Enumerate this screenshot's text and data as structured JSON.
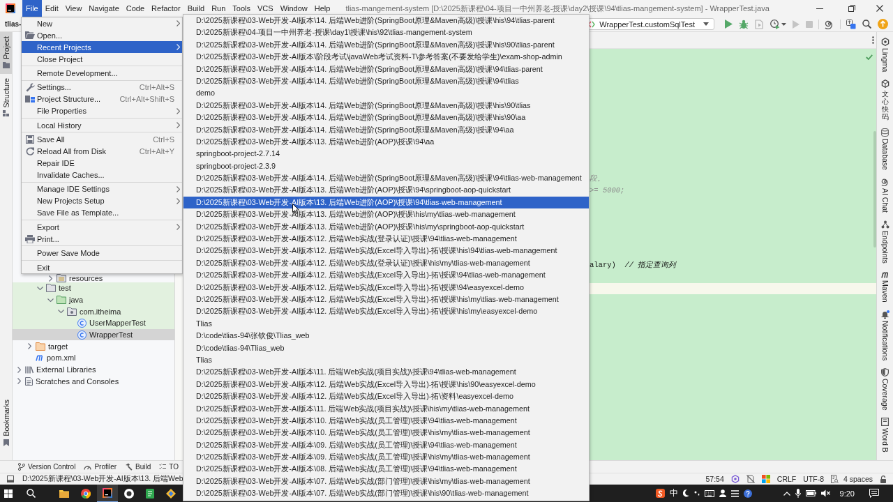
{
  "menu_bar": {
    "items": [
      {
        "label": "File",
        "selected": true
      },
      {
        "label": "Edit",
        "selected": false
      },
      {
        "label": "View",
        "selected": false
      },
      {
        "label": "Navigate",
        "selected": false
      },
      {
        "label": "Code",
        "selected": false
      },
      {
        "label": "Refactor",
        "selected": false
      },
      {
        "label": "Build",
        "selected": false
      },
      {
        "label": "Run",
        "selected": false
      },
      {
        "label": "Tools",
        "selected": false
      },
      {
        "label": "VCS",
        "selected": false
      },
      {
        "label": "Window",
        "selected": false
      },
      {
        "label": "Help",
        "selected": false
      }
    ],
    "title": "tlias-mangement-system [D:\\2025新课程\\04-项目一中州养老-授课\\day2\\授课\\94\\tlias-mangement-system] - WrapperTest.java"
  },
  "toolbar": {
    "project": "tlias-",
    "run_configuration": "WrapperTest.customSqlTest"
  },
  "left_strip": {
    "top": [
      {
        "label": "Project",
        "selected": true
      },
      {
        "label": "Structure",
        "selected": false
      }
    ],
    "bottom": [
      {
        "label": "Bookmarks",
        "selected": false
      }
    ]
  },
  "project_tree": [
    {
      "children": [
        {
          "children": [
            {
              "children": [
                {
                  "label": "resources",
                  "kind": "resources-folder",
                  "expanded": false,
                  "selected": false
                }
              ]
            },
            {
              "label": "test",
              "kind": "test-folder",
              "expanded": true,
              "selected": false,
              "children": [
                {
                  "label": "java",
                  "kind": "test-sources-folder",
                  "expanded": true,
                  "selected": false,
                  "children": [
                    {
                      "label": "com.itheima",
                      "kind": "package",
                      "expanded": true,
                      "selected": false,
                      "children": [
                        {
                          "label": "UserMapperTest",
                          "kind": "test-class",
                          "selected": false
                        },
                        {
                          "label": "WrapperTest",
                          "kind": "test-class",
                          "selected": true
                        }
                      ]
                    }
                  ]
                }
              ]
            }
          ]
        },
        {
          "label": "target",
          "kind": "excluded-folder",
          "expanded": false,
          "selected": false
        },
        {
          "label": "pom.xml",
          "kind": "maven-file",
          "selected": false
        }
      ]
    },
    {
      "label": "External Libraries",
      "kind": "libraries",
      "expanded": false,
      "selected": false
    },
    {
      "label": "Scratches and Consoles",
      "kind": "scratches",
      "expanded": false,
      "selected": false
    }
  ],
  "editor": {
    "lines": [
      {
        "kind": "comment",
        "text": "段。"
      },
      {
        "kind": "comment",
        "text": ">= 5000;"
      },
      {
        "kind": "code",
        "text": "alary)  *// 指定查询列*"
      }
    ]
  },
  "right_strip": [
    {
      "label": "Lingma"
    },
    {
      "label": "文心快码"
    },
    {
      "label": "Database"
    },
    {
      "label": "AI Chat"
    },
    {
      "label": "Endpoints"
    },
    {
      "label": "Maven"
    },
    {
      "label": "Notifications"
    },
    {
      "label": "Coverage"
    },
    {
      "label": "Word B"
    }
  ],
  "bottom_tools": [
    {
      "label": "Version Control"
    },
    {
      "label": "Profiler"
    },
    {
      "label": "Build"
    },
    {
      "label": "TO"
    }
  ],
  "status_bar": {
    "path": "D:\\2025新课程\\03-Web开发-AI版本\\13. 后端Web",
    "caret": "57:54",
    "line_separator": "CRLF",
    "encoding": "UTF-8",
    "indent": "4 spaces"
  },
  "taskbar": {
    "input_mode": "中",
    "time": "9:20"
  },
  "file_menu": {
    "groups": [
      {
        "items": [
          {
            "label": "New",
            "submenu": true,
            "selected": false
          },
          {
            "label": "Open...",
            "submenu": false,
            "selected": false
          },
          {
            "label": "Recent Projects",
            "submenu": true,
            "selected": true
          },
          {
            "label": "Close Project",
            "submenu": false,
            "selected": false
          }
        ]
      },
      {
        "items": [
          {
            "label": "Remote Development...",
            "submenu": false,
            "selected": false
          }
        ]
      },
      {
        "items": [
          {
            "label": "Settings...",
            "shortcut": "Ctrl+Alt+S",
            "submenu": false,
            "selected": false
          },
          {
            "label": "Project Structure...",
            "shortcut": "Ctrl+Alt+Shift+S",
            "submenu": false,
            "selected": false
          },
          {
            "label": "File Properties",
            "submenu": true,
            "selected": false
          }
        ]
      },
      {
        "items": [
          {
            "label": "Local History",
            "submenu": true,
            "selected": false
          }
        ]
      },
      {
        "items": [
          {
            "label": "Save All",
            "shortcut": "Ctrl+S",
            "submenu": false,
            "selected": false
          },
          {
            "label": "Reload All from Disk",
            "shortcut": "Ctrl+Alt+Y",
            "submenu": false,
            "selected": false
          },
          {
            "label": "Repair IDE",
            "submenu": false,
            "selected": false
          },
          {
            "label": "Invalidate Caches...",
            "submenu": false,
            "selected": false
          }
        ]
      },
      {
        "items": [
          {
            "label": "Manage IDE Settings",
            "submenu": true,
            "selected": false
          },
          {
            "label": "New Projects Setup",
            "submenu": true,
            "selected": false
          },
          {
            "label": "Save File as Template...",
            "submenu": false,
            "selected": false
          }
        ]
      },
      {
        "items": [
          {
            "label": "Export",
            "submenu": true,
            "selected": false
          },
          {
            "label": "Print...",
            "submenu": false,
            "selected": false
          }
        ]
      },
      {
        "items": [
          {
            "label": "Power Save Mode",
            "submenu": false,
            "selected": false
          }
        ]
      },
      {
        "items": [
          {
            "label": "Exit",
            "submenu": false,
            "selected": false
          }
        ]
      }
    ]
  },
  "recent_projects": [
    {
      "path": "D:\\2025新课程\\03-Web开发-AI版本\\14. 后端Web进阶(SpringBoot原理&Maven高级)\\授课\\his\\94\\tlias-parent",
      "selected": false
    },
    {
      "path": "D:\\2025新课程\\04-项目一中州养老-授课\\day1\\授课\\his\\92\\tlias-mangement-system",
      "selected": false
    },
    {
      "path": "D:\\2025新课程\\03-Web开发-AI版本\\14. 后端Web进阶(SpringBoot原理&Maven高级)\\授课\\his\\90\\tlias-parent",
      "selected": false
    },
    {
      "path": "D:\\2025新课程\\03-Web开发-AI版本\\阶段考试\\javaWeb考试资料-T\\参考答案(不要发给学生)\\exam-shop-admin",
      "selected": false
    },
    {
      "path": "D:\\2025新课程\\03-Web开发-AI版本\\14. 后端Web进阶(SpringBoot原理&Maven高级)\\授课\\94\\tlias-parent",
      "selected": false
    },
    {
      "path": "D:\\2025新课程\\03-Web开发-AI版本\\14. 后端Web进阶(SpringBoot原理&Maven高级)\\授课\\94\\tlias",
      "selected": false
    },
    {
      "path": "demo",
      "selected": false
    },
    {
      "path": "D:\\2025新课程\\03-Web开发-AI版本\\14. 后端Web进阶(SpringBoot原理&Maven高级)\\授课\\his\\90\\tlias",
      "selected": false
    },
    {
      "path": "D:\\2025新课程\\03-Web开发-AI版本\\14. 后端Web进阶(SpringBoot原理&Maven高级)\\授课\\his\\90\\aa",
      "selected": false
    },
    {
      "path": "D:\\2025新课程\\03-Web开发-AI版本\\14. 后端Web进阶(SpringBoot原理&Maven高级)\\授课\\94\\aa",
      "selected": false
    },
    {
      "path": "D:\\2025新课程\\03-Web开发-AI版本\\13. 后端Web进阶(AOP)\\授课\\94\\aa",
      "selected": false
    },
    {
      "path": "springboot-project-2.7.14",
      "selected": false
    },
    {
      "path": "springboot-project-2.3.9",
      "selected": false
    },
    {
      "path": "D:\\2025新课程\\03-Web开发-AI版本\\14. 后端Web进阶(SpringBoot原理&Maven高级)\\授课\\94\\tlias-web-management",
      "selected": false
    },
    {
      "path": "D:\\2025新课程\\03-Web开发-AI版本\\13. 后端Web进阶(AOP)\\授课\\94\\springboot-aop-quickstart",
      "selected": false
    },
    {
      "path": "D:\\2025新课程\\03-Web开发-AI版本\\13. 后端Web进阶(AOP)\\授课\\94\\tlias-web-management",
      "selected": true
    },
    {
      "path": "D:\\2025新课程\\03-Web开发-AI版本\\13. 后端Web进阶(AOP)\\授课\\his\\my\\tlias-web-management",
      "selected": false
    },
    {
      "path": "D:\\2025新课程\\03-Web开发-AI版本\\13. 后端Web进阶(AOP)\\授课\\his\\my\\springboot-aop-quickstart",
      "selected": false
    },
    {
      "path": "D:\\2025新课程\\03-Web开发-AI版本\\12. 后端Web实战(登录认证)\\授课\\94\\tlias-web-management",
      "selected": false
    },
    {
      "path": "D:\\2025新课程\\03-Web开发-AI版本\\12. 后端Web实战(Excel导入导出)-拓\\授课\\his\\94\\tlias-web-management",
      "selected": false
    },
    {
      "path": "D:\\2025新课程\\03-Web开发-AI版本\\12. 后端Web实战(登录认证)\\授课\\his\\my\\tlias-web-management",
      "selected": false
    },
    {
      "path": "D:\\2025新课程\\03-Web开发-AI版本\\12. 后端Web实战(Excel导入导出)-拓\\授课\\94\\tlias-web-management",
      "selected": false
    },
    {
      "path": "D:\\2025新课程\\03-Web开发-AI版本\\12. 后端Web实战(Excel导入导出)-拓\\授课\\94\\easyexcel-demo",
      "selected": false
    },
    {
      "path": "D:\\2025新课程\\03-Web开发-AI版本\\12. 后端Web实战(Excel导入导出)-拓\\授课\\his\\my\\tlias-web-management",
      "selected": false
    },
    {
      "path": "D:\\2025新课程\\03-Web开发-AI版本\\12. 后端Web实战(Excel导入导出)-拓\\授课\\his\\my\\easyexcel-demo",
      "selected": false
    },
    {
      "path": "Tlias",
      "selected": false
    },
    {
      "path": "D:\\code\\tlias-94\\张钦俊\\Tlias_web",
      "selected": false
    },
    {
      "path": "D:\\code\\tlias-94\\Tlias_web",
      "selected": false
    },
    {
      "path": "Tlias",
      "selected": false
    },
    {
      "path": "D:\\2025新课程\\03-Web开发-AI版本\\11. 后端Web实战(项目实战)\\授课\\94\\tlias-web-management",
      "selected": false
    },
    {
      "path": "D:\\2025新课程\\03-Web开发-AI版本\\12. 后端Web实战(Excel导入导出)-拓\\授课\\his\\90\\easyexcel-demo",
      "selected": false
    },
    {
      "path": "D:\\2025新课程\\03-Web开发-AI版本\\12. 后端Web实战(Excel导入导出)-拓\\资料\\easyexcel-demo",
      "selected": false
    },
    {
      "path": "D:\\2025新课程\\03-Web开发-AI版本\\11. 后端Web实战(项目实战)\\授课\\his\\my\\tlias-web-management",
      "selected": false
    },
    {
      "path": "D:\\2025新课程\\03-Web开发-AI版本\\10. 后端Web实战(员工管理)\\授课\\94\\tlias-web-management",
      "selected": false
    },
    {
      "path": "D:\\2025新课程\\03-Web开发-AI版本\\10. 后端Web实战(员工管理)\\授课\\his\\my\\tlias-web-management",
      "selected": false
    },
    {
      "path": "D:\\2025新课程\\03-Web开发-AI版本\\09. 后端Web实战(员工管理)\\授课\\94\\tlias-web-management",
      "selected": false
    },
    {
      "path": "D:\\2025新课程\\03-Web开发-AI版本\\09. 后端Web实战(员工管理)\\授课\\his\\my\\tlias-web-management",
      "selected": false
    },
    {
      "path": "D:\\2025新课程\\03-Web开发-AI版本\\08. 后端Web实战(员工管理)\\授课\\94\\tlias-web-management",
      "selected": false
    },
    {
      "path": "D:\\2025新课程\\03-Web开发-AI版本\\07. 后端Web实战(部门管理)\\授课\\his\\my\\tlias-web-management",
      "selected": false
    },
    {
      "path": "D:\\2025新课程\\03-Web开发-AI版本\\07. 后端Web实战(部门管理)\\授课\\his\\90\\tlias-web-management",
      "selected": false
    }
  ]
}
